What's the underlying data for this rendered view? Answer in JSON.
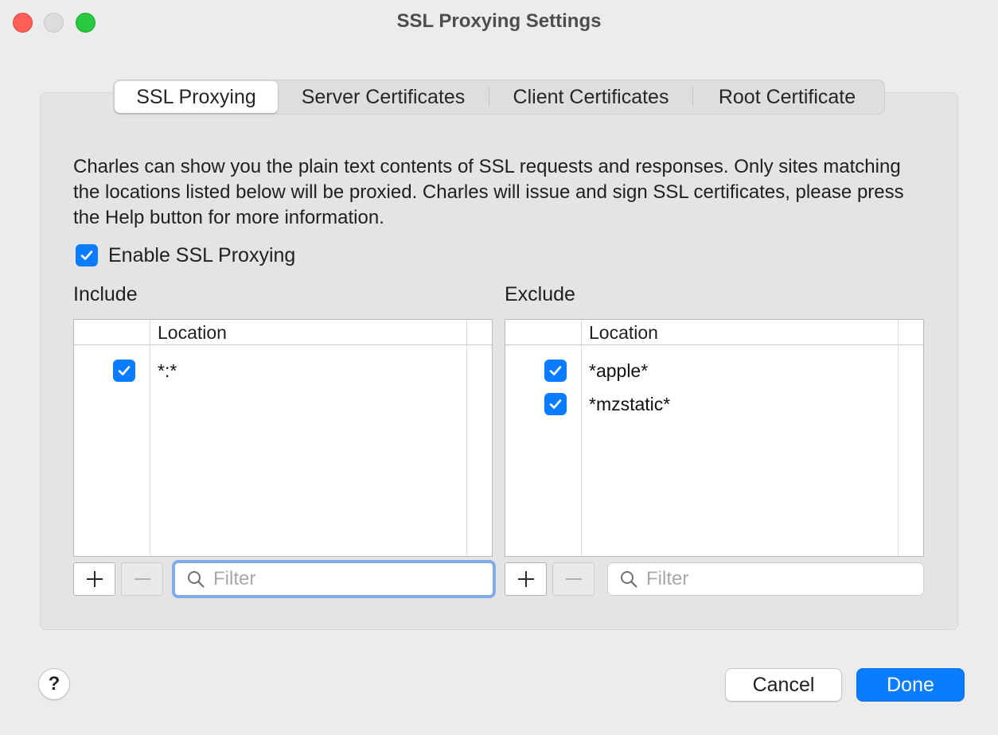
{
  "window": {
    "title": "SSL Proxying Settings"
  },
  "tabs": [
    {
      "label": "SSL Proxying",
      "selected": true
    },
    {
      "label": "Server Certificates",
      "selected": false
    },
    {
      "label": "Client Certificates",
      "selected": false
    },
    {
      "label": "Root Certificate",
      "selected": false
    }
  ],
  "description": "Charles can show you the plain text contents of SSL requests and responses. Only sites matching the locations listed below will be proxied. Charles will issue and sign SSL certificates, please press the Help button for more information.",
  "enable_ssl": {
    "label": "Enable SSL Proxying",
    "checked": true
  },
  "include": {
    "label": "Include",
    "column_header": "Location",
    "rows": [
      {
        "checked": true,
        "location": "*:*"
      }
    ],
    "add_label": "+",
    "remove_label": "−",
    "filter_placeholder": "Filter",
    "filter_value": ""
  },
  "exclude": {
    "label": "Exclude",
    "column_header": "Location",
    "rows": [
      {
        "checked": true,
        "location": "*apple*"
      },
      {
        "checked": true,
        "location": "*mzstatic*"
      }
    ],
    "add_label": "+",
    "remove_label": "−",
    "filter_placeholder": "Filter",
    "filter_value": ""
  },
  "footer": {
    "help_label": "?",
    "cancel_label": "Cancel",
    "done_label": "Done"
  },
  "colors": {
    "accent": "#0a7cff",
    "close": "#ff5f57",
    "minimize": "#dcdcdc",
    "maximize": "#28c840",
    "focus_ring": "#7fabea"
  }
}
